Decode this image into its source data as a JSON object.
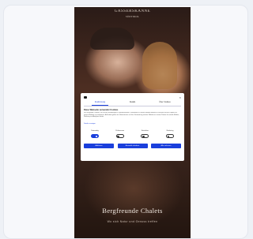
{
  "site": {
    "brand_line1": "GASSERSKANNE",
    "brand_line2": "SÜDTIROL"
  },
  "consent": {
    "tabs": [
      {
        "label": "Zustimmung",
        "active": true
      },
      {
        "label": "Details",
        "active": false
      },
      {
        "label": "Über Cookies",
        "active": false
      }
    ],
    "title": "Diese Webseite verwendet Cookies",
    "body": "Wir verwenden Cookies, um Inhalte und Anzeigen zu personalisieren, Funktionen für soziale Medien anbieten zu können und die Zugriffe auf unsere Website zu analysieren. Außerdem geben wir Informationen zu Ihrer Verwendung unserer Website an unsere Partner für soziale Medien, Werbung und Analysen weiter.",
    "link": "Details anzeigen",
    "toggles": [
      {
        "label": "Notwendig",
        "on": true
      },
      {
        "label": "Präferenzen",
        "on": false
      },
      {
        "label": "Statistiken",
        "on": false
      },
      {
        "label": "Marketing",
        "on": false
      }
    ],
    "buttons": [
      {
        "label": "Ablehnen"
      },
      {
        "label": "Auswahl erlauben"
      },
      {
        "label": "Alle zulassen"
      }
    ],
    "accent": "#1a3fdc"
  },
  "hero": {
    "title": "Bergfreunde Chalets",
    "subtitle": "Wo sich Natur und Genuss treffen"
  }
}
